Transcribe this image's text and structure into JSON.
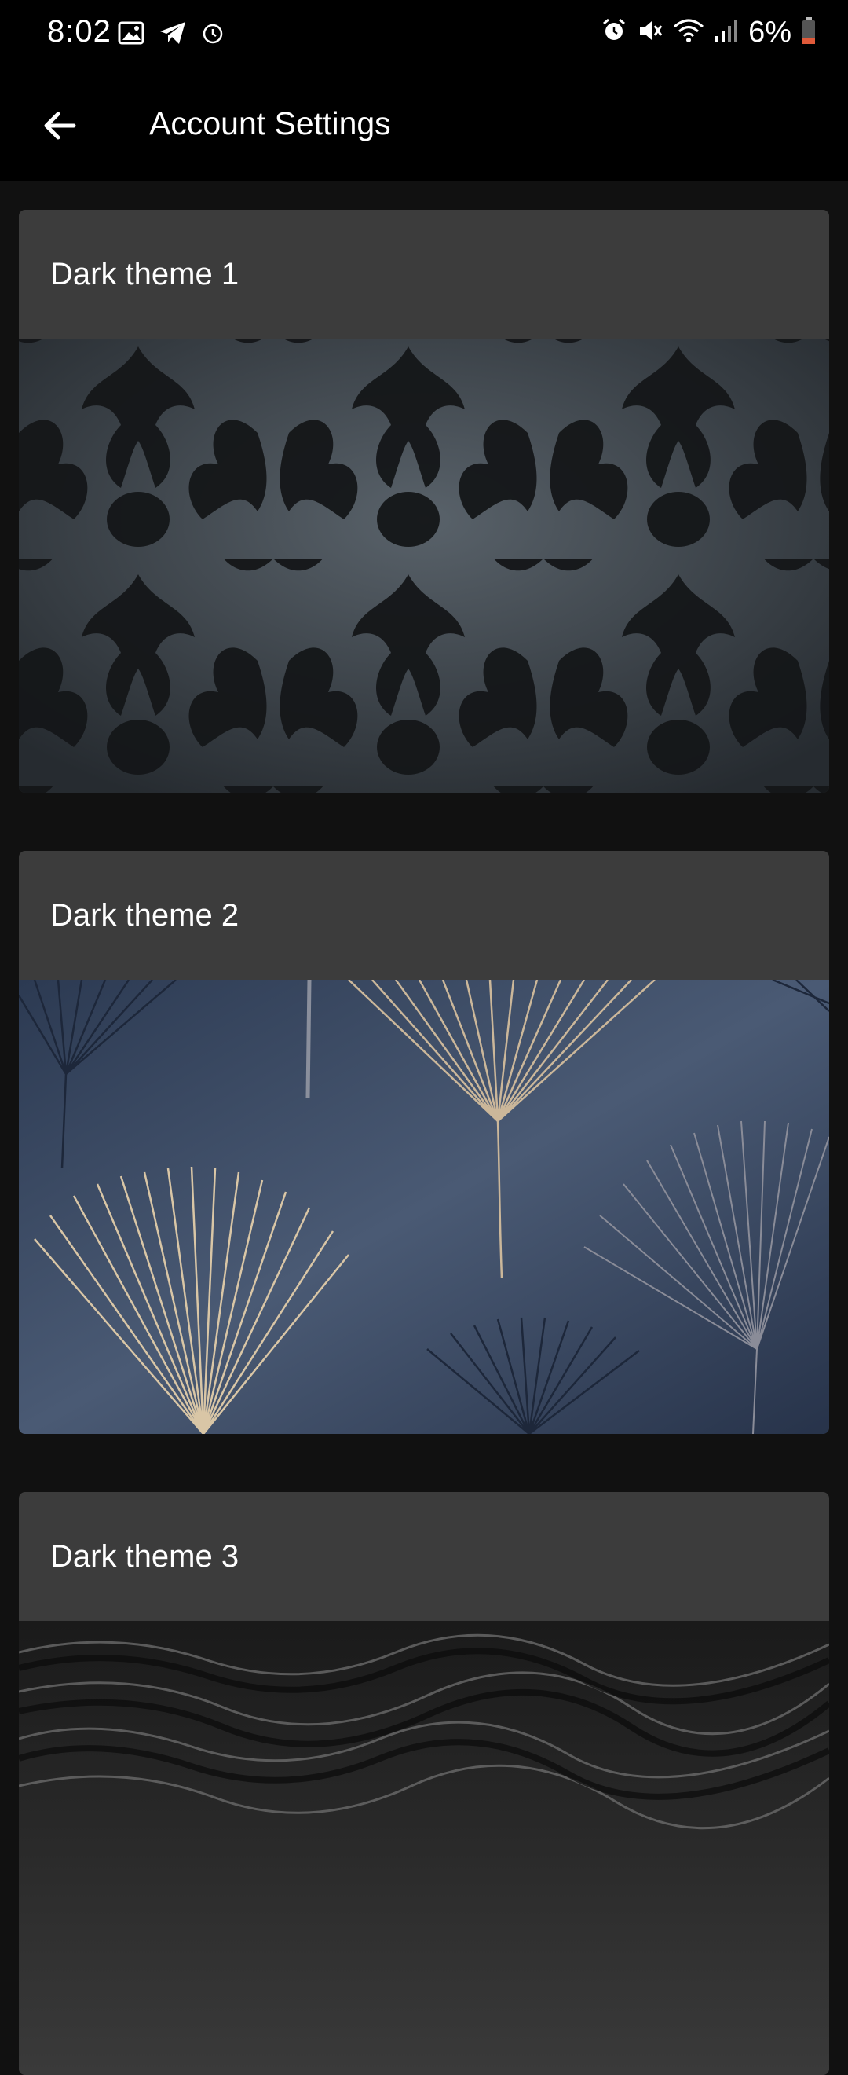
{
  "status_bar": {
    "time": "8:02",
    "left_icons": [
      "image-icon",
      "telegram-icon",
      "alarm-clock-icon"
    ],
    "right_icons": [
      "alarm-icon",
      "mute-icon",
      "wifi-icon",
      "signal-icon",
      "battery-low-icon"
    ],
    "battery": "6%"
  },
  "app_bar": {
    "title": "Account Settings",
    "back_icon": "arrow-back-icon"
  },
  "themes": [
    {
      "label": "Dark theme 1",
      "image": "damask-pattern"
    },
    {
      "label": "Dark theme 2",
      "image": "ginkgo-leaves"
    },
    {
      "label": "Dark theme 3",
      "image": "black-sand"
    }
  ],
  "colors": {
    "background": "#111111",
    "bar": "#000000",
    "card": "#3c3c3c",
    "battery_low": "#e05a3a"
  }
}
